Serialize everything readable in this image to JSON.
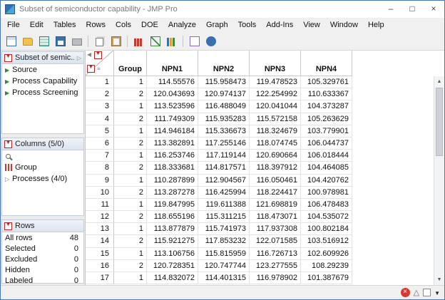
{
  "window": {
    "title": "Subset of semiconductor capability - JMP Pro",
    "controls": {
      "minimize": "–",
      "maximize": "□",
      "close": "×"
    }
  },
  "menu": [
    "File",
    "Edit",
    "Tables",
    "Rows",
    "Cols",
    "DOE",
    "Analyze",
    "Graph",
    "Tools",
    "Add-Ins",
    "View",
    "Window",
    "Help"
  ],
  "toolbar": {
    "icons": [
      {
        "name": "new-data-table-icon",
        "glyph": "table"
      },
      {
        "name": "open-icon",
        "glyph": "folder"
      },
      {
        "name": "import-icon",
        "glyph": "grid2"
      },
      {
        "name": "save-icon",
        "glyph": "save"
      },
      {
        "name": "print-icon",
        "glyph": "print"
      },
      {
        "name": "separator",
        "glyph": "sep"
      },
      {
        "name": "copy-icon",
        "glyph": "copy"
      },
      {
        "name": "paste-icon",
        "glyph": "paste"
      },
      {
        "name": "separator",
        "glyph": "sep"
      },
      {
        "name": "distribution-icon",
        "glyph": "dist"
      },
      {
        "name": "fit-y-by-x-icon",
        "glyph": "fit"
      },
      {
        "name": "graph-builder-icon",
        "glyph": "graph"
      },
      {
        "name": "separator",
        "glyph": "sep"
      },
      {
        "name": "journal-icon",
        "glyph": "journal"
      },
      {
        "name": "help-icon",
        "glyph": "help"
      }
    ]
  },
  "sidebar": {
    "table_panel": {
      "title": "Subset of semic...",
      "items": [
        "Source",
        "Process Capability",
        "Process Screening"
      ]
    },
    "columns_panel": {
      "title": "Columns (5/0)",
      "items": [
        {
          "label": "Group",
          "icon": "histogram"
        },
        {
          "label": "Processes (4/0)",
          "icon": "disclosure"
        }
      ]
    },
    "rows_panel": {
      "title": "Rows",
      "stats": [
        {
          "label": "All rows",
          "value": "48"
        },
        {
          "label": "Selected",
          "value": "0"
        },
        {
          "label": "Excluded",
          "value": "0"
        },
        {
          "label": "Hidden",
          "value": "0"
        },
        {
          "label": "Labeled",
          "value": "0"
        }
      ]
    }
  },
  "table": {
    "columns": [
      "Group",
      "NPN1",
      "NPN2",
      "NPN3",
      "NPN4"
    ],
    "rows": [
      {
        "n": "1",
        "cells": [
          "1",
          "114.55576",
          "115.958473",
          "119.478523",
          "105.329761"
        ]
      },
      {
        "n": "2",
        "cells": [
          "2",
          "120.043693",
          "120.974137",
          "122.254992",
          "110.633367"
        ]
      },
      {
        "n": "3",
        "cells": [
          "1",
          "113.523596",
          "116.488049",
          "120.041044",
          "104.373287"
        ]
      },
      {
        "n": "4",
        "cells": [
          "2",
          "111.749309",
          "115.935283",
          "115.572158",
          "105.263629"
        ]
      },
      {
        "n": "5",
        "cells": [
          "1",
          "114.946184",
          "115.336673",
          "118.324679",
          "103.779901"
        ]
      },
      {
        "n": "6",
        "cells": [
          "2",
          "113.382891",
          "117.255146",
          "118.074745",
          "106.044737"
        ]
      },
      {
        "n": "7",
        "cells": [
          "1",
          "116.253746",
          "117.119144",
          "120.690664",
          "106.018444"
        ]
      },
      {
        "n": "8",
        "cells": [
          "2",
          "118.333681",
          "114.817571",
          "118.397912",
          "104.464085"
        ]
      },
      {
        "n": "9",
        "cells": [
          "1",
          "110.287899",
          "112.904567",
          "116.050461",
          "104.420762"
        ]
      },
      {
        "n": "10",
        "cells": [
          "2",
          "113.287278",
          "116.425994",
          "118.224417",
          "100.978981"
        ]
      },
      {
        "n": "11",
        "cells": [
          "1",
          "119.847995",
          "119.611388",
          "121.698819",
          "106.478483"
        ]
      },
      {
        "n": "12",
        "cells": [
          "2",
          "118.655196",
          "115.311215",
          "118.473071",
          "104.535072"
        ]
      },
      {
        "n": "13",
        "cells": [
          "1",
          "113.877879",
          "115.741973",
          "117.937308",
          "100.802184"
        ]
      },
      {
        "n": "14",
        "cells": [
          "2",
          "115.921275",
          "117.853232",
          "122.071585",
          "103.516912"
        ]
      },
      {
        "n": "15",
        "cells": [
          "1",
          "113.106756",
          "115.815959",
          "116.726713",
          "102.609926"
        ]
      },
      {
        "n": "16",
        "cells": [
          "2",
          "120.728351",
          "120.747744",
          "123.277555",
          "108.29239"
        ]
      },
      {
        "n": "17",
        "cells": [
          "1",
          "114.832072",
          "114.401315",
          "116.978902",
          "101.387679"
        ]
      }
    ]
  }
}
